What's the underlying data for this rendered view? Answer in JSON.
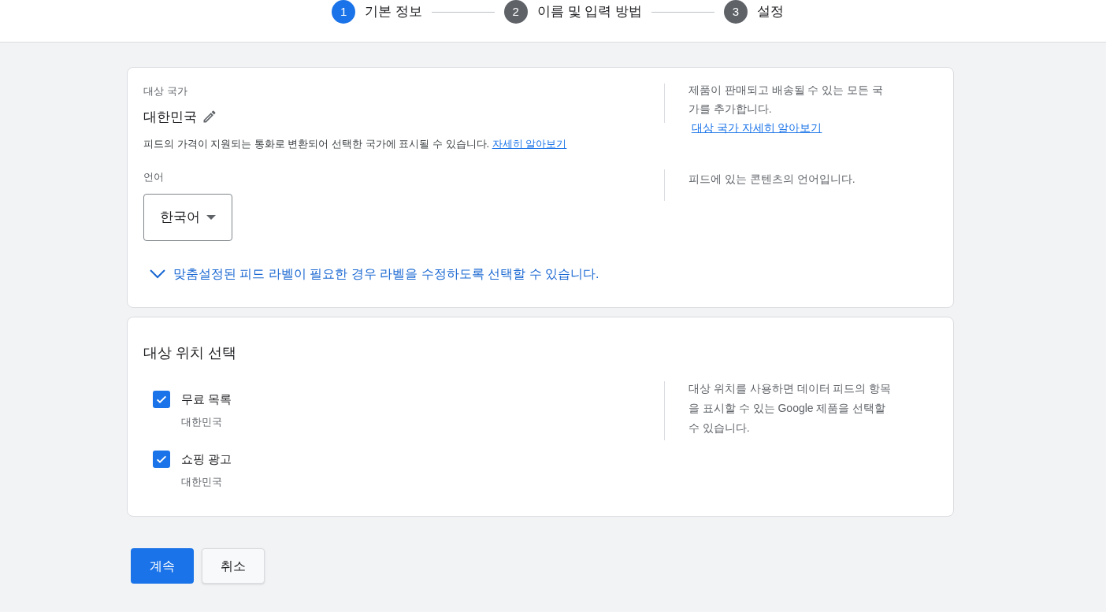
{
  "steps": [
    {
      "number": "1",
      "label": "기본 정보",
      "selected": true
    },
    {
      "number": "2",
      "label": "이름 및 입력 방법",
      "selected": false
    },
    {
      "number": "3",
      "label": "설정",
      "selected": false
    }
  ],
  "country_card": {
    "country_label": "대상 국가",
    "country_value": "대한민국",
    "country_note": "피드의 가격이 지원되는 통화로 변환되어 선택한 국가에 표시될 수 있습니다.",
    "country_note_link": "자세히 알아보기",
    "country_help": "제품이 판매되고 배송될 수 있는 모든 국가를 추가합니다.",
    "country_help_link": "대상 국가 자세히 알아보기",
    "language_label": "언어",
    "language_value": "한국어",
    "language_help": "피드에 있는 콘텐츠의 언어입니다.",
    "labels_toggle": {
      "text": "맞춤설정된 피드 라벨이 필요한 경우 라벨을 수정하도록 선택할 수 있습니다.",
      "expanded": false
    }
  },
  "destinations_card": {
    "title": "대상 위치 선택",
    "help": "대상 위치를 사용하면 데이터 피드의 항목을 표시할 수 있는 Google 제품을 선택할 수 있습니다.",
    "options": [
      {
        "label": "무료 목록",
        "sublabel": "대한민국",
        "checked": true
      },
      {
        "label": "쇼핑 광고",
        "sublabel": "대한민국",
        "checked": true
      }
    ]
  },
  "buttons": {
    "primary": "계속",
    "secondary": "취소"
  }
}
